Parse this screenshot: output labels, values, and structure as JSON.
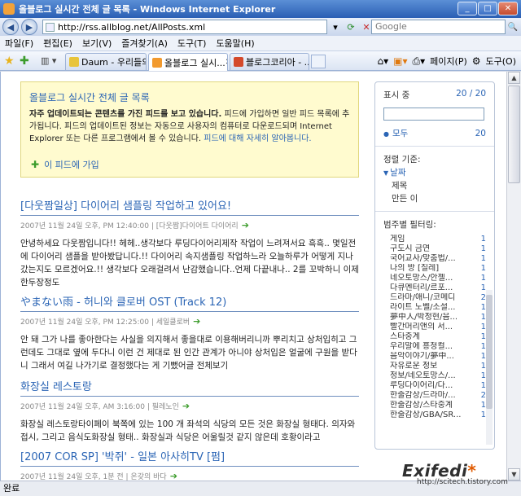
{
  "window": {
    "title": "올블로그 실시간 전체 글 목록 - Windows Internet Explorer",
    "min": "_",
    "max": "□",
    "close": "✕"
  },
  "address": {
    "url": "http://rss.allblog.net/AllPosts.xml",
    "search_placeholder": "Google"
  },
  "menu": [
    "파일(F)",
    "편집(E)",
    "보기(V)",
    "즐겨찾기(A)",
    "도구(T)",
    "도움말(H)"
  ],
  "tabs": [
    {
      "label": "Daum - 우리들의...",
      "color": "#e8c43a"
    },
    {
      "label": "올블로그 실시...",
      "color": "#f29a2e",
      "close": "✕"
    },
    {
      "label": "블로그코리아 - ...",
      "color": "#d4492b"
    }
  ],
  "tools": {
    "page": "페이지(P)",
    "tools": "도구(O)"
  },
  "info": {
    "title": "올블로그 실시간 전체 글 목록",
    "bold": "자주 업데이트되는 콘텐츠를 가진 피드를 보고 있습니다.",
    "text": " 피드에 가입하면 일반 피드 목록에 추가됩니다. 피드의 업데이트된 정보는 자동으로 사용자의 컴퓨터로 다운로드되며 Internet Explorer 또는 다른 프로그램에서 볼 수 있습니다. ",
    "link": "피드에 대해 자세히 알아봅니다.",
    "subscribe": "이 피드에 가입"
  },
  "posts": [
    {
      "title": "[다웃짬일상] 다이어리 샘플링 작업하고 있어요!",
      "meta": "2007년 11월 24일 오후, PM 12:40:00 | [다웃짬]다이어트 다이어리",
      "body": "안녕하세요 다웃짬입니다!! 헤헤..생각보다 루딩다이어리제작 작업이 느려져서요 흑흑.. 몇일전에 다이어리 샘플을 받아봤답니다.!! 다이어리 속지샘플링 작업하느라 오늘하루가 어떻게 지나갔는지도 모르겠어요.!! 생각보다 오래걸려서 난감했습니다..언제 다끝내나.. 2를 꼬박하니 이제 한두장정도"
    },
    {
      "title": "やまない雨 - 허니와 클로버 OST (Track 12)",
      "meta": "2007년 11월 24일 오후, PM 12:25:00 | 세일클로버",
      "body": "안 돼 그가 나를 좋아한다는 사실을 의지해서 좋을대로 이용해버리니까 뿌리치고 상처입히고 그런데도 그대로 옆에 두다니 이런 건 제대로 된 인간 관계가 아니야 상처입은 얼굴에 구원을 받다니 그래서 여길 나가기로 결정했다는 게 기뻤어글 전체보기"
    },
    {
      "title": "화장실 레스토랑",
      "meta": "2007년 11월 24일 오후, AM 3:16:00 | 필레노인",
      "body": "화장실 레스토랑타이페이 북쪽에 있는 100 개 좌석의 식당의 모든 것은 화장실 형태다. 의자와 접시, 그리고 음식도화장실 형태.. 화장실과 식당은 어울릴것 같지 않은데 호황이라고"
    },
    {
      "title": "[2007 COR SP] '박쥐' - 일본 아사히TV [펌]",
      "meta": "2007년 11월 24일 오후, 1분 전 | 온갖의 바다",
      "body": ""
    }
  ],
  "side": {
    "display": "표시 중",
    "display_count": "20 / 20",
    "all": "모두",
    "all_count": "20",
    "sort_label": "정렬 기준:",
    "sort": [
      "날짜",
      "제목",
      "만든 이"
    ],
    "filter_label": "범주별 필터링:",
    "categories": [
      {
        "name": "게임",
        "count": "1"
      },
      {
        "name": "구도시 금연",
        "count": "1"
      },
      {
        "name": "국어교사/맞춤법/...",
        "count": "1"
      },
      {
        "name": "나의 방 [질레]",
        "count": "1"
      },
      {
        "name": "네오토망스/안젤...",
        "count": "1"
      },
      {
        "name": "다큐멘터리/르포...",
        "count": "1"
      },
      {
        "name": "드라마/애니/코메디",
        "count": "2"
      },
      {
        "name": "라이트 노벨/소설...",
        "count": "1"
      },
      {
        "name": "夢中人/박정현/음...",
        "count": "1"
      },
      {
        "name": "빨간머리앤의 서...",
        "count": "1"
      },
      {
        "name": "스타중계",
        "count": "1"
      },
      {
        "name": "우리말에 흥청컬...",
        "count": "1"
      },
      {
        "name": "음악이야기/夢中...",
        "count": "1"
      },
      {
        "name": "자유로운 정보",
        "count": "1"
      },
      {
        "name": "정보/네오토망스/...",
        "count": "1"
      },
      {
        "name": "루딩다이어리/다...",
        "count": "1"
      },
      {
        "name": "한줄감상/드라마/...",
        "count": "2"
      },
      {
        "name": "한줄감상/스타중계",
        "count": "1"
      },
      {
        "name": "한줄감상/GBA/SR...",
        "count": "1"
      }
    ]
  },
  "status": "완료",
  "watermark": {
    "brand": "Exifedi",
    "star": "*",
    "url": "http://scitech.tistory.com"
  }
}
